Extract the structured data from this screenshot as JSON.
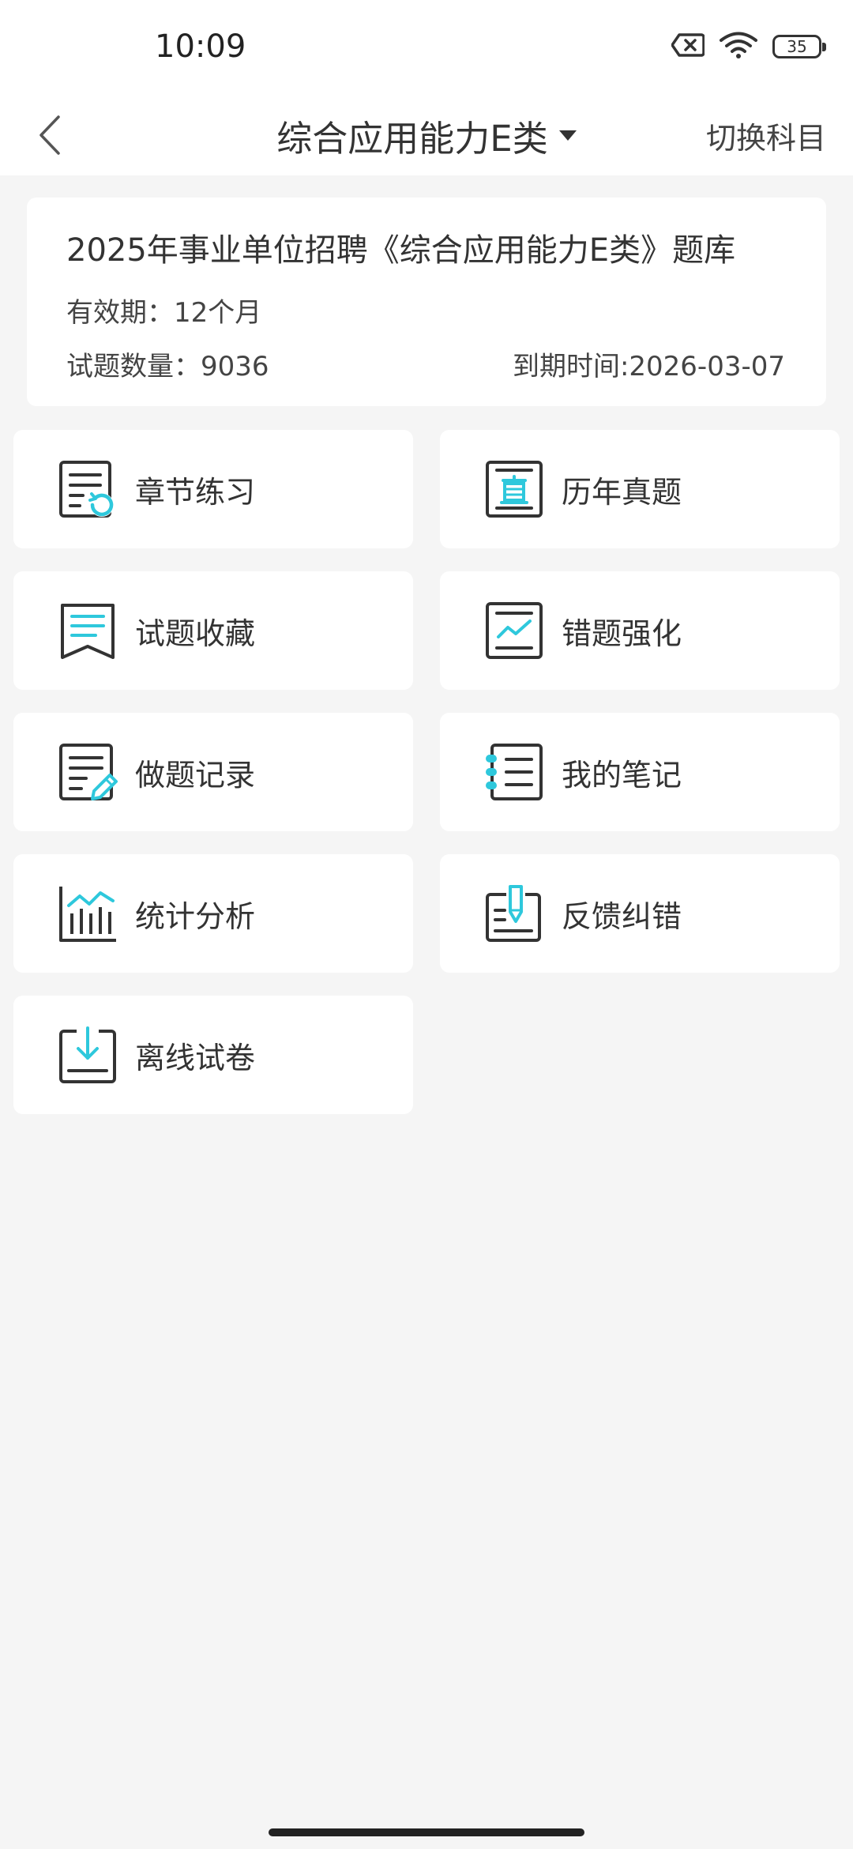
{
  "status_bar": {
    "time": "10:09",
    "battery_level": "35",
    "icons": [
      "sim-none-icon",
      "wifi-icon",
      "battery-icon"
    ]
  },
  "header": {
    "title": "综合应用能力E类",
    "switch_label": "切换科目",
    "icons": [
      "back-chevron-icon",
      "caret-down-icon"
    ]
  },
  "info_card": {
    "title": "2025年事业单位招聘《综合应用能力E类》题库",
    "validity": "有效期：12个月",
    "question_count": "试题数量：9036",
    "expiry": "到期时间:2026-03-07"
  },
  "menu": [
    {
      "label": "章节练习",
      "icon": "chapter-practice-icon"
    },
    {
      "label": "历年真题",
      "icon": "past-papers-icon"
    },
    {
      "label": "试题收藏",
      "icon": "favorites-icon"
    },
    {
      "label": "错题强化",
      "icon": "wrong-questions-icon"
    },
    {
      "label": "做题记录",
      "icon": "practice-record-icon"
    },
    {
      "label": "我的笔记",
      "icon": "notes-icon"
    },
    {
      "label": "统计分析",
      "icon": "statistics-icon"
    },
    {
      "label": "反馈纠错",
      "icon": "feedback-icon"
    },
    {
      "label": "离线试卷",
      "icon": "offline-download-icon"
    }
  ],
  "colors": {
    "accent": "#2ec8dc",
    "icon_dark": "#333333",
    "background": "#f5f5f5",
    "card": "#ffffff"
  }
}
